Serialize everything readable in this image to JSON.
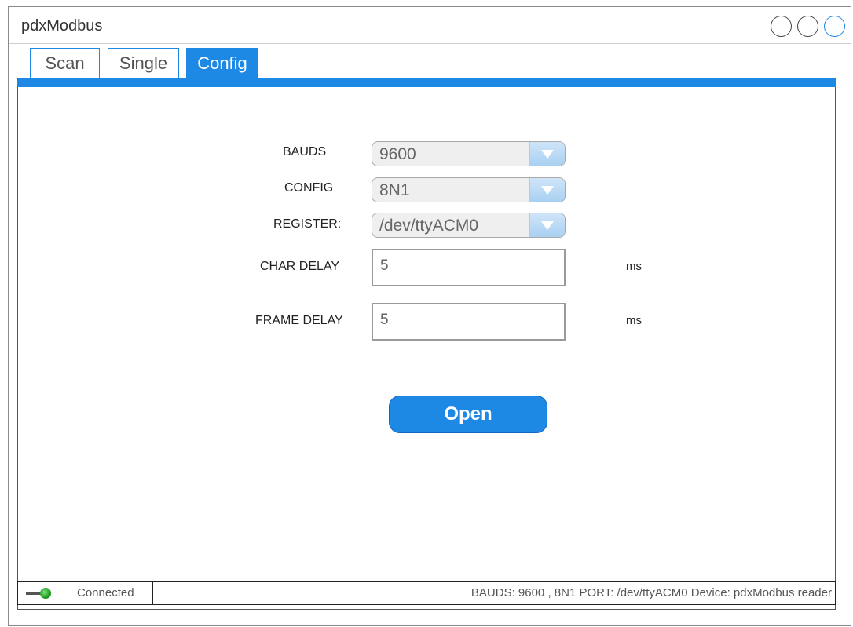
{
  "app": {
    "title": "pdxModbus"
  },
  "tabs": [
    {
      "label": "Scan",
      "active": false
    },
    {
      "label": "Single",
      "active": false
    },
    {
      "label": "Config",
      "active": true
    }
  ],
  "form": {
    "bauds": {
      "label": "BAUDS",
      "value": "9600"
    },
    "config": {
      "label": "CONFIG",
      "value": "8N1"
    },
    "register": {
      "label": "REGISTER:",
      "value": "/dev/ttyACM0"
    },
    "char_delay": {
      "label": "CHAR DELAY",
      "value": "5",
      "unit": "ms"
    },
    "frame_delay": {
      "label": "FRAME DELAY",
      "value": "5",
      "unit": "ms"
    }
  },
  "open_button": {
    "label": "Open"
  },
  "status": {
    "connection": "Connected",
    "info": "BAUDS: 9600 , 8N1 PORT: /dev/ttyACM0 Device: pdxModbus reader"
  },
  "colors": {
    "accent": "#1e88e5",
    "status_ok": "#1f9a1f"
  },
  "icons": {
    "window_controls": [
      "circle-icon",
      "circle-icon",
      "circle-icon"
    ],
    "status": "plug-icon"
  }
}
